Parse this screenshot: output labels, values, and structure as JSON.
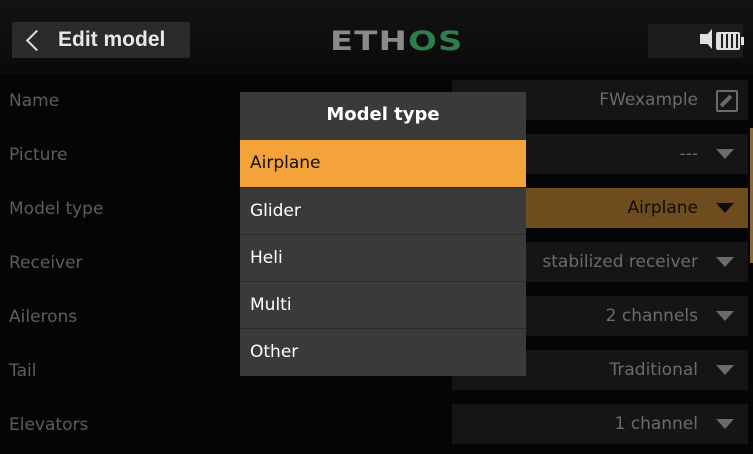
{
  "header": {
    "title": "Edit model",
    "logo_part1": "ETH",
    "logo_part2": "OS",
    "icons": [
      "back-chevron-icon",
      "speaker-icon",
      "battery-icon"
    ]
  },
  "rows": [
    {
      "label": "Name",
      "value": "FWexample",
      "icon": "edit-icon"
    },
    {
      "label": "Picture",
      "value": "---"
    },
    {
      "label": "Model type",
      "value": "Airplane",
      "active": true
    },
    {
      "label": "Receiver",
      "value": "stabilized receiver"
    },
    {
      "label": "Ailerons",
      "value": "2 channels"
    },
    {
      "label": "Tail",
      "value": "Traditional"
    },
    {
      "label": "Elevators",
      "value": "1 channel"
    }
  ],
  "popup": {
    "title": "Model type",
    "selected": "Airplane",
    "options": [
      "Airplane",
      "Glider",
      "Heli",
      "Multi",
      "Other"
    ]
  },
  "colors": {
    "accent": "#f4a23a",
    "active_row": "#6f4c1e",
    "logo_green": "#2e7d4f",
    "popup_bg": "#3a3a3a"
  }
}
